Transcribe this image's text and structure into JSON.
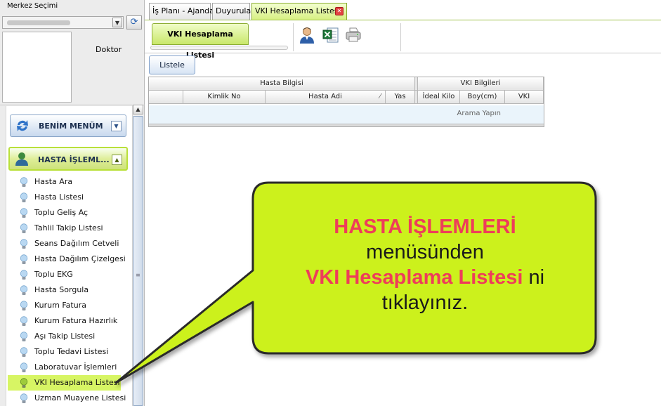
{
  "left_panel": {
    "merkez_label": "Merkez Seçimi",
    "doctor_label": "Doktor",
    "menus": {
      "benim_menum": "BENİM MENÜM",
      "hasta_islemleri": "HASTA İŞLEML..."
    },
    "items": [
      {
        "label": "Hasta Ara"
      },
      {
        "label": "Hasta Listesi"
      },
      {
        "label": "Toplu Geliş Aç"
      },
      {
        "label": "Tahlil Takip Listesi"
      },
      {
        "label": "Seans Dağılım Cetveli"
      },
      {
        "label": "Hasta Dağılım Çizelgesi"
      },
      {
        "label": "Toplu EKG"
      },
      {
        "label": "Hasta Sorgula"
      },
      {
        "label": "Kurum Fatura"
      },
      {
        "label": "Kurum Fatura Hazırlık"
      },
      {
        "label": "Aşı Takip Listesi"
      },
      {
        "label": "Toplu Tedavi Listesi"
      },
      {
        "label": "Laboratuvar İşlemleri"
      },
      {
        "label": "VKI Hesaplama Listesi",
        "active": true
      },
      {
        "label": "Uzman Muayene Listesi"
      }
    ]
  },
  "tabs": [
    {
      "label": "İş Planı - Ajanda"
    },
    {
      "label": "Duyurular"
    },
    {
      "label": "VKI Hesaplama Listesi",
      "active": true
    }
  ],
  "toolbar": {
    "subtab_label": "VKI Hesaplama Listesi",
    "icons": [
      "user-icon",
      "excel-export-icon",
      "printer-icon"
    ]
  },
  "listele_label": "Listele",
  "grid": {
    "group_headers": [
      "Hasta Bilgisi",
      "VKI Bilgileri"
    ],
    "columns": [
      "Kimlik No",
      "Hasta Adi",
      "Yas",
      "İdeal Kilo",
      "Boy(cm)",
      "VKI"
    ],
    "empty_text": "Arama Yapın"
  },
  "callout": {
    "line1": "HASTA İŞLEMLERİ",
    "line2": "menüsünden",
    "line3_red": "VKI Hesaplama Listesi",
    "line3_rest": " ni",
    "line4": "tıklayınız."
  },
  "colors": {
    "highlight_green": "#d7f564",
    "callout_fill": "#ccf11a",
    "callout_red": "#ee3d5a"
  }
}
